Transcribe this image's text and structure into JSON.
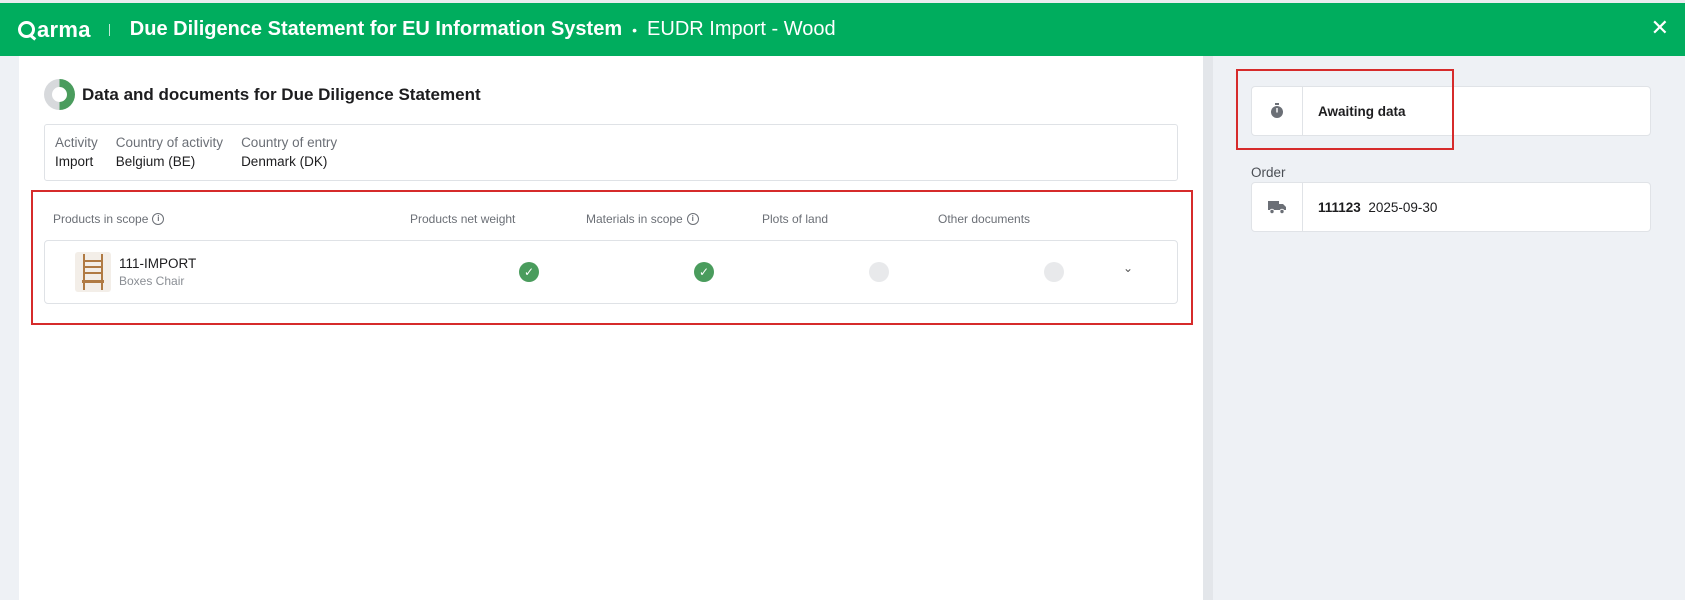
{
  "header": {
    "brand": "arma",
    "title": "Due Diligence Statement for EU Information System",
    "subtitle": "EUDR Import - Wood",
    "close": "✕"
  },
  "section": {
    "title": "Data and documents for Due Diligence Statement",
    "progress": 0.5
  },
  "info": [
    {
      "label": "Activity",
      "value": "Import"
    },
    {
      "label": "Country of activity",
      "value": "Belgium (BE)"
    },
    {
      "label": "Country of entry",
      "value": "Denmark (DK)"
    }
  ],
  "columns": {
    "products": "Products in scope",
    "weight": "Products net weight",
    "materials": "Materials in scope",
    "plots": "Plots of land",
    "documents": "Other documents"
  },
  "product": {
    "code": "111-IMPORT",
    "name": "Boxes Chair",
    "weight_done": true,
    "materials_done": true,
    "plots_done": false,
    "documents_done": false
  },
  "side": {
    "status": "Awaiting data",
    "order_label": "Order",
    "order_id": "111123",
    "order_date": "2025-09-30"
  }
}
